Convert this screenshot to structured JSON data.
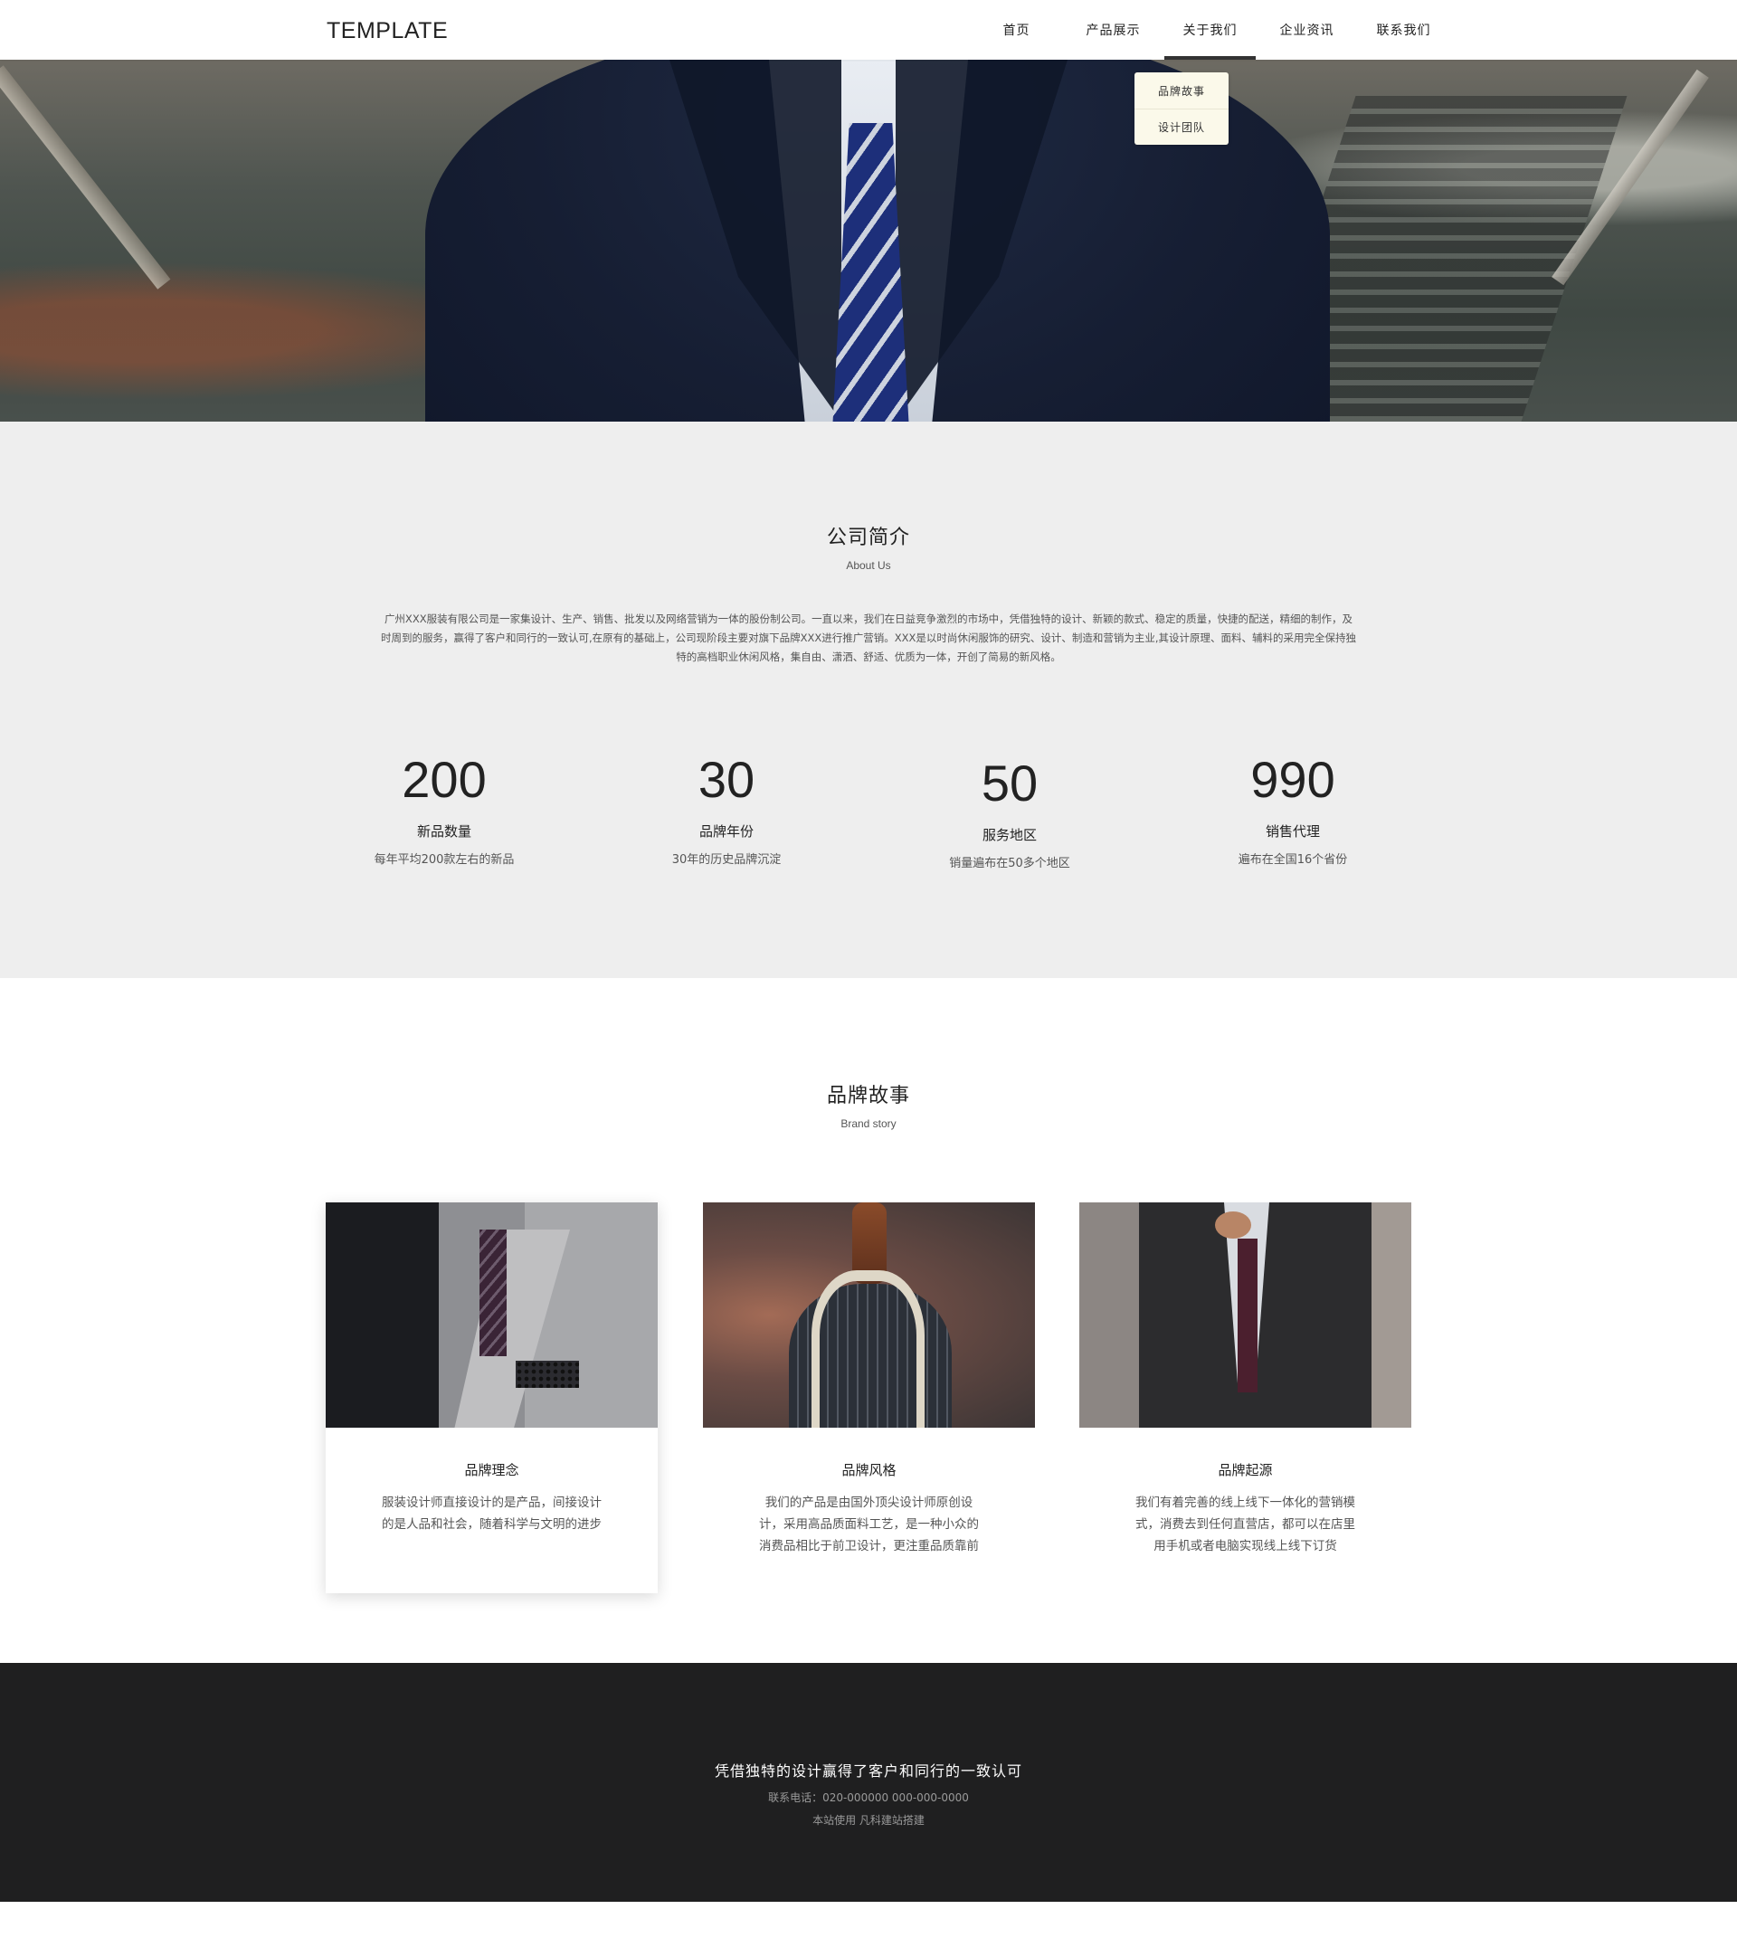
{
  "header": {
    "logo": "TEMPLATE",
    "nav": [
      {
        "label": "首页"
      },
      {
        "label": "产品展示"
      },
      {
        "label": "关于我们"
      },
      {
        "label": "企业资讯"
      },
      {
        "label": "联系我们"
      }
    ],
    "dropdown": [
      {
        "label": "品牌故事"
      },
      {
        "label": "设计团队"
      }
    ]
  },
  "about": {
    "title": "公司简介",
    "subtitle": "About Us",
    "text": "广州XXX服装有限公司是一家集设计、生产、销售、批发以及网络营销为一体的股份制公司。一直以来，我们在日益竞争激烈的市场中，凭借独特的设计、新颖的款式、稳定的质量，快捷的配送，精细的制作，及时周到的服务，赢得了客户和同行的一致认可,在原有的基础上，公司现阶段主要对旗下品牌XXX进行推广营销。XXX是以时尚休闲服饰的研究、设计、制造和营销为主业,其设计原理、面料、辅料的采用完全保持独特的高档职业休闲风格，集自由、潇洒、舒适、优质为一体，开创了简易的新风格。",
    "stats": [
      {
        "number": "200",
        "title": "新品数量",
        "desc": "每年平均200款左右的新品"
      },
      {
        "number": "30",
        "title": "品牌年份",
        "desc": "30年的历史品牌沉淀"
      },
      {
        "number": "50",
        "title": "服务地区",
        "desc": "销量遍布在50多个地区"
      },
      {
        "number": "990",
        "title": "销售代理",
        "desc": "遍布在全国16个省份"
      }
    ]
  },
  "brand": {
    "title": "品牌故事",
    "subtitle": "Brand story",
    "cards": [
      {
        "title": "品牌理念",
        "text": "服装设计师直接设计的是产品，间接设计的是人品和社会，随着科学与文明的进步"
      },
      {
        "title": "品牌风格",
        "text": "我们的产品是由国外顶尖设计师原创设计，采用高品质面料工艺，是一种小众的消费品相比于前卫设计，更注重品质靠前"
      },
      {
        "title": "品牌起源",
        "text": "我们有着完善的线上线下一体化的营销模式，消费去到任何直营店，都可以在店里用手机或者电脑实现线上线下订货"
      }
    ]
  },
  "footer": {
    "slogan": "凭借独特的设计赢得了客户和同行的一致认可",
    "contact": "联系电话：020-000000  000-000-0000",
    "credit": "本站使用  凡科建站搭建"
  }
}
